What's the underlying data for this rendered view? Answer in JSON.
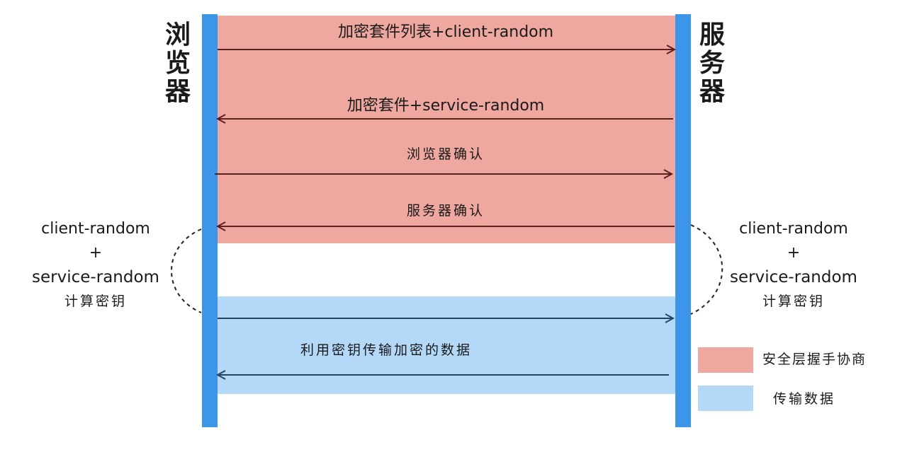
{
  "colors": {
    "handshake_band": "#eea8a0",
    "data_band": "#b3d8f8",
    "lifeline": "#3d95ea",
    "arrow": "#5a1f1f",
    "data_arrow": "#23465f"
  },
  "browser_label": [
    "浏",
    "览",
    "器"
  ],
  "server_label": [
    "服",
    "务",
    "器"
  ],
  "messages": [
    {
      "text": "加密套件列表+client-random",
      "direction": "right"
    },
    {
      "text": "加密套件+service-random",
      "direction": "left"
    },
    {
      "text": "浏览器确认",
      "direction": "right"
    },
    {
      "text": "服务器确认",
      "direction": "left"
    },
    {
      "text": "利用密钥传输加密的数据",
      "direction": "both"
    }
  ],
  "left_calc": {
    "line1": "client-random",
    "line2": "+",
    "line3": "service-random",
    "line4": "计算密钥"
  },
  "right_calc": {
    "line1": "client-random",
    "line2": "+",
    "line3": "service-random",
    "line4": "计算密钥"
  },
  "legend": [
    {
      "label": "安全层握手协商",
      "color": "#eea8a0"
    },
    {
      "label": "传输数据",
      "color": "#b3d8f8"
    }
  ]
}
